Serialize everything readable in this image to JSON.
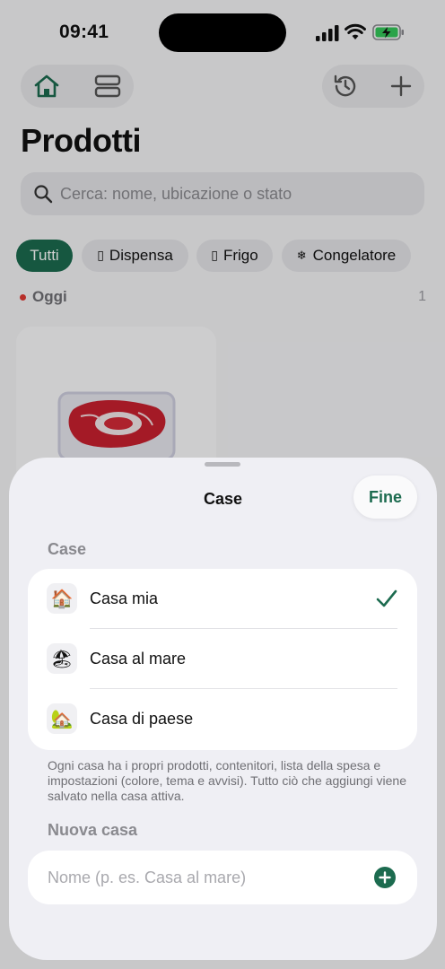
{
  "status_bar": {
    "time": "09:41"
  },
  "header": {
    "title": "Prodotti",
    "nav_icons": [
      "home-icon",
      "layout-icon",
      "history-icon",
      "plus-icon"
    ]
  },
  "search": {
    "placeholder": "Cerca: nome, ubicazione o stato"
  },
  "filters": [
    {
      "label": "Tutti",
      "icon": "",
      "active": true
    },
    {
      "label": "Dispensa",
      "icon": "▯",
      "active": false
    },
    {
      "label": "Frigo",
      "icon": "▯",
      "active": false
    },
    {
      "label": "Congelatore",
      "icon": "❄",
      "active": false
    }
  ],
  "section": {
    "label": "Oggi",
    "count": "1"
  },
  "sheet": {
    "title": "Case",
    "done_label": "Fine",
    "houses_label": "Case",
    "houses": [
      {
        "label": "Casa mia",
        "emoji": "🏠",
        "selected": true
      },
      {
        "label": "Casa al mare",
        "emoji": "🏖",
        "selected": false
      },
      {
        "label": "Casa di paese",
        "emoji": "🏡",
        "selected": false
      }
    ],
    "footnote": "Ogni casa ha i propri prodotti, contenitori, lista della spesa e impostazioni (colore, tema e avvisi). Tutto ciò che aggiungi viene salvato nella casa attiva.",
    "new_house_label": "Nuova casa",
    "new_house_placeholder": "Nome (p. es. Casa al mare)"
  },
  "colors": {
    "accent": "#1c6b4f",
    "today_dot": "#e03a33"
  }
}
